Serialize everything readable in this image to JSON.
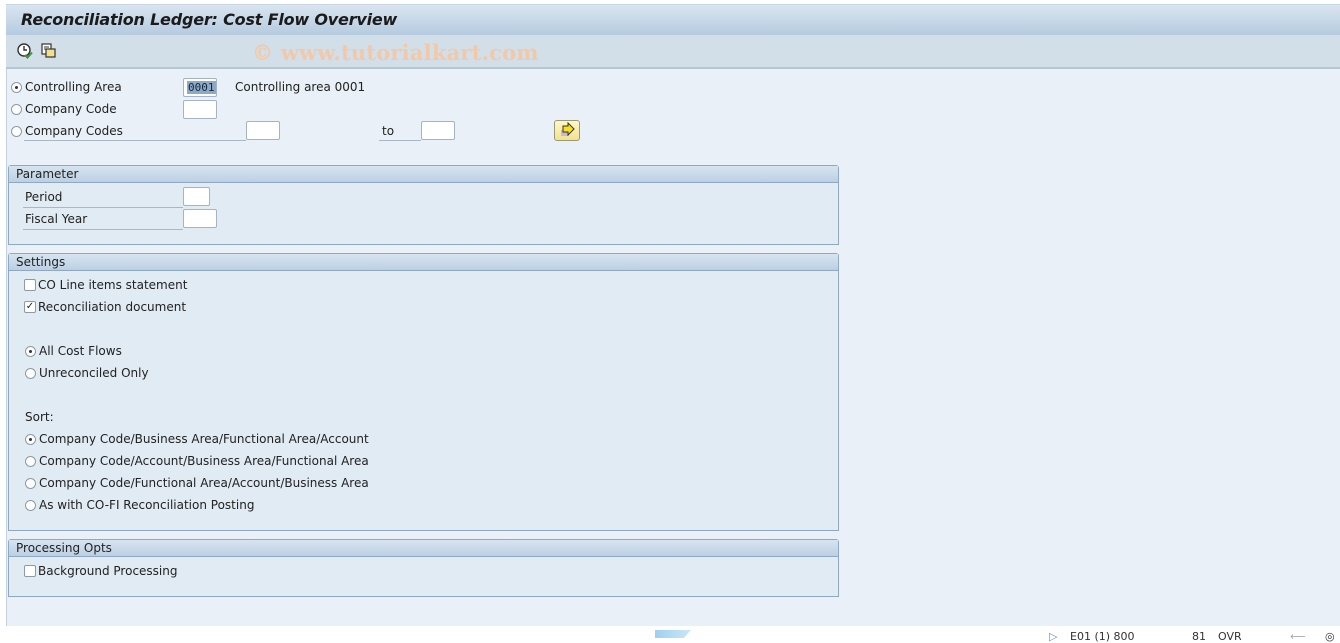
{
  "window": {
    "title": "Reconciliation Ledger: Cost Flow Overview",
    "watermark": "© www.tutorialkart.com"
  },
  "toolbar": {
    "icons": [
      {
        "name": "execute-with-time-check-icon",
        "tooltip": ""
      },
      {
        "name": "get-variant-icon",
        "tooltip": ""
      }
    ]
  },
  "selection": {
    "controlling_area": {
      "label": "Controlling Area",
      "selected": true,
      "value": "0001",
      "description": "Controlling area 0001"
    },
    "company_code": {
      "label": "Company Code",
      "selected": false,
      "value": ""
    },
    "company_codes": {
      "label": "Company Codes",
      "selected": false,
      "from": "",
      "to_label": "to",
      "to": ""
    },
    "multiple_selection_icon": "arrow-right-multiple-selection-icon"
  },
  "parameter": {
    "title": "Parameter",
    "period": {
      "label": "Period",
      "value": ""
    },
    "fiscal_year": {
      "label": "Fiscal Year",
      "value": ""
    }
  },
  "settings": {
    "title": "Settings",
    "co_line_items": {
      "label": "CO Line items statement",
      "checked": false
    },
    "reconciliation_document": {
      "label": "Reconciliation document",
      "checked": true
    },
    "flows": [
      {
        "label": "All Cost Flows",
        "selected": true
      },
      {
        "label": "Unreconciled Only",
        "selected": false
      }
    ],
    "sort_label": "Sort:",
    "sort_options": [
      {
        "label": "Company Code/Business Area/Functional Area/Account",
        "selected": true
      },
      {
        "label": "Company Code/Account/Business Area/Functional Area",
        "selected": false
      },
      {
        "label": "Company Code/Functional Area/Account/Business Area",
        "selected": false
      },
      {
        "label": "As with CO-FI Reconciliation Posting",
        "selected": false
      }
    ]
  },
  "processing": {
    "title": "Processing Opts",
    "background": {
      "label": "Background Processing",
      "checked": false
    }
  },
  "statusbar": {
    "system": "E01 (1) 800",
    "field2": "81",
    "field3": "OVR"
  }
}
